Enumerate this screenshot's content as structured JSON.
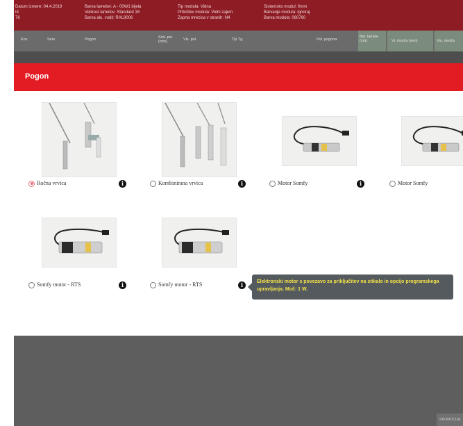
{
  "info_bar": {
    "col1": [
      "Datum izmere: 04.4.2019",
      "t4",
      "76"
    ],
    "col2": [
      "Barva lamelov: A - 00W1 bijela",
      "Velikost lamelov: Standard 16",
      "Barva alu. vodil: RAL9006"
    ],
    "col3": [
      "Tip modula: Vidna",
      "Pritrditev modula: Vidni zajem",
      "Zaprta mrezica v stranih: N4"
    ],
    "col4": [
      "Sistemsko modul: 0mm",
      "Barvanje modula: ignoraj",
      "Barva modula: 060760"
    ]
  },
  "columns": [
    "Kos",
    "Serv",
    "Pogon",
    "Sirš. pol. (mm)",
    "Vis. pol.",
    "Tip Tg.",
    "Pol. pogona",
    "Bel. lamele (cm)",
    "Vi. mreža (mm)",
    "Vis. mreža"
  ],
  "modal": {
    "title": "Pogon"
  },
  "options": [
    {
      "label": "Ročna vrvica",
      "selected": true,
      "image": "crank-handles"
    },
    {
      "label": "Kombinirana vrvica",
      "selected": false,
      "image": "crank-handles"
    },
    {
      "label": "Motor Somfy",
      "selected": false,
      "image": "motor-cable"
    },
    {
      "label": "Motor Somfy",
      "selected": false,
      "image": "motor-cable"
    },
    {
      "label": "Somfy motor - RTS",
      "selected": false,
      "image": "motor-unit"
    },
    {
      "label": "Somfy motor - RTS",
      "selected": false,
      "image": "motor-unit"
    }
  ],
  "tooltip": {
    "text": "Elektronski motor s povezavo za priključitev na stikalo in opcijo programskega upravljanja. Moč: 1 W."
  },
  "footer": {
    "corner_label": "PROMOCIJA"
  },
  "colors": {
    "header_red": "#8e1c24",
    "modal_red": "#e31b23",
    "tooltip_text": "#f3e24a"
  }
}
